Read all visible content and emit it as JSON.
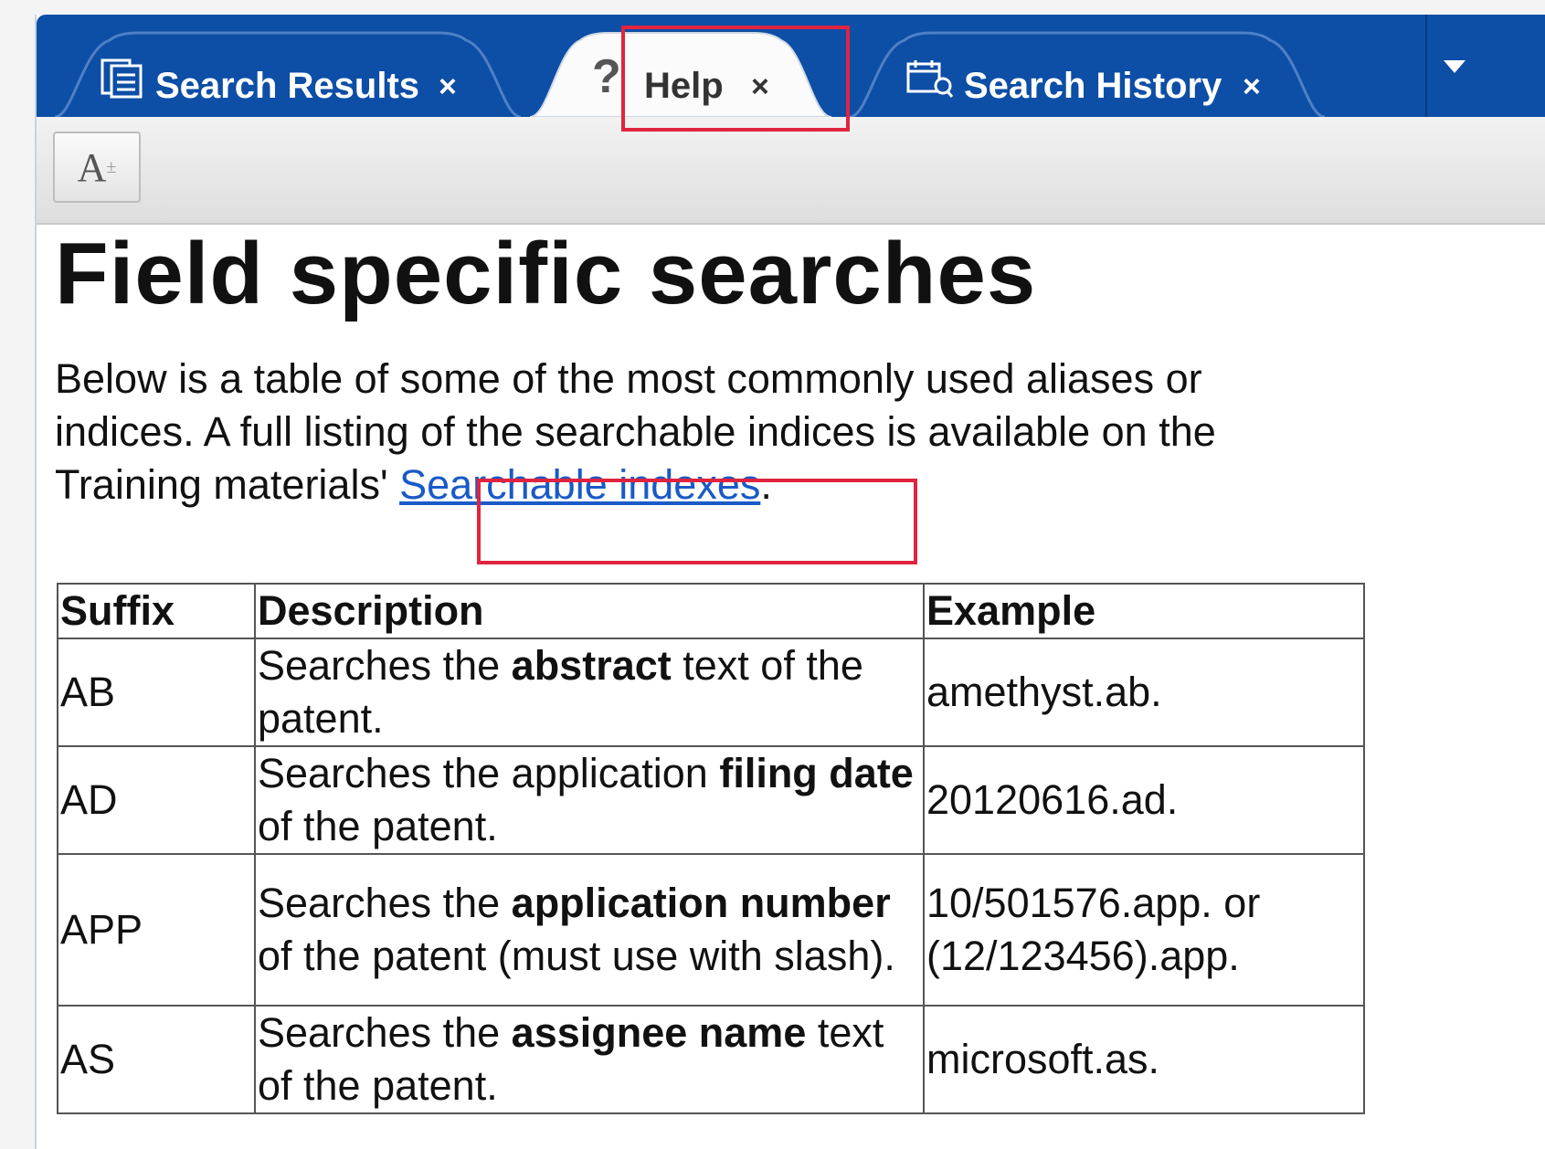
{
  "tabs": [
    {
      "label": "Search Results",
      "icon": "search-results-icon",
      "close": "×"
    },
    {
      "label": "Help",
      "icon": "help-icon",
      "close": "×",
      "active": true
    },
    {
      "label": "Search History",
      "icon": "search-history-icon",
      "close": "×"
    }
  ],
  "toolbar": {
    "font_button": "A",
    "font_button_sup": "±"
  },
  "page": {
    "title": "Field specific searches",
    "intro_line1": "Below is a table of some of the most commonly used aliases or",
    "intro_line2": "indices.  A full listing of the searchable indices is available on the",
    "intro_line3": "Training materials'",
    "link": "Searchable indexes",
    "link_suffix": "."
  },
  "table": {
    "headers": [
      "Suffix",
      "Description",
      "Example"
    ],
    "rows": [
      {
        "suffix": "AB",
        "d1": "Searches the ",
        "b": "abstract",
        "d2": " text of the patent.",
        "example": "amethyst.ab."
      },
      {
        "suffix": "AD",
        "d1": "Searches the application ",
        "b": "filing date",
        "d2": " of the patent.",
        "example": "20120616.ad."
      },
      {
        "suffix": "APP",
        "d1": "Searches the ",
        "b": "application number",
        "d2": " of the patent (must use with slash).",
        "example": "10/501576.app. or (12/123456).app."
      },
      {
        "suffix": "AS",
        "d1": "Searches the ",
        "b": "assignee name",
        "d2": " text of the patent.",
        "example": "microsoft.as."
      }
    ]
  },
  "colors": {
    "tab_bar": "#0d4ea6",
    "highlight": "#e0243f",
    "link": "#1a5ac7"
  }
}
